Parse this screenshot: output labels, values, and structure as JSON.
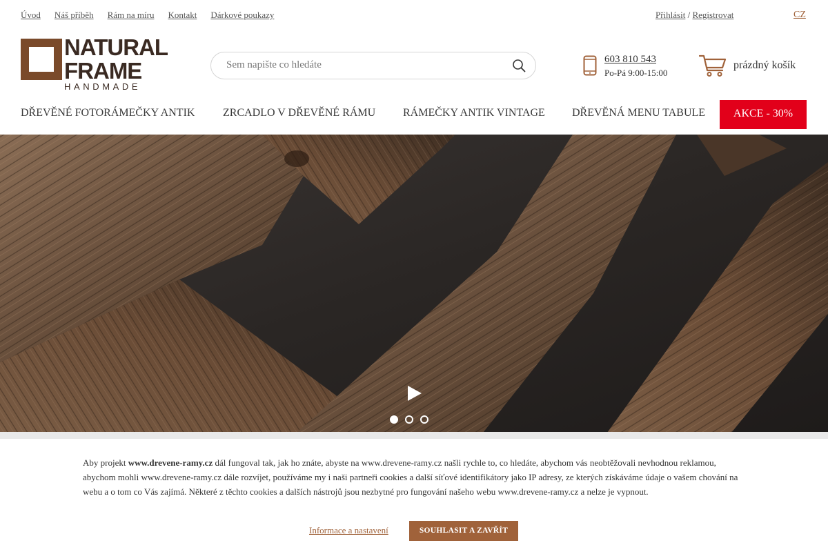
{
  "top_links": [
    "Úvod",
    "Náš příběh",
    "Rám na míru",
    "Kontakt",
    "Dárkové poukazy"
  ],
  "auth": {
    "login": "Přihlásit",
    "separator": " / ",
    "register": "Registrovat"
  },
  "language": "CZ",
  "logo": {
    "line1": "NATURAL",
    "line2": "FRAME",
    "line3": "HANDMADE"
  },
  "search": {
    "placeholder": "Sem napište co hledáte",
    "icon": "search-icon"
  },
  "contact": {
    "phone": "603 810 543",
    "hours": "Po-Pá 9:00-15:00",
    "icon": "smartphone-icon"
  },
  "cart": {
    "label": "prázdný košík",
    "icon": "shopping-cart-icon"
  },
  "nav": {
    "items": [
      "DŘEVĚNÉ FOTORÁMEČKY ANTIK",
      "ZRCADLO V DŘEVĚNÉ RÁMU",
      "RÁMEČKY ANTIK VINTAGE",
      "DŘEVĚNÁ MENU TABULE"
    ],
    "sale": "AKCE - 30%"
  },
  "slider": {
    "slide_count": 3,
    "active_slide": 1,
    "play_icon": "play-icon"
  },
  "colors": {
    "brand": "#a0623a",
    "sale": "#e2001a",
    "logo_dark": "#3a2a22",
    "logo_frame": "#7a4a2a"
  },
  "cookie": {
    "intro": "Aby projekt ",
    "site": "www.drevene-ramy.cz",
    "body": " dál fungoval tak, jak ho znáte, abyste na www.drevene-ramy.cz našli rychle to, co hledáte, abychom vás neobtěžovali nevhodnou reklamou, abychom mohli www.drevene-ramy.cz dále rozvíjet, používáme my i naši partneři cookies a další síťové identifikátory jako IP adresy, ze kterých získáváme údaje o vašem chování na webu a o tom co Vás zajímá. Některé z těchto cookies a dalších nástrojů jsou nezbytné pro fungování našeho webu www.drevene-ramy.cz a nelze je vypnout.",
    "info_link": "Informace a nastavení",
    "agree_button": "SOUHLASIT A ZAVŘÍT"
  }
}
